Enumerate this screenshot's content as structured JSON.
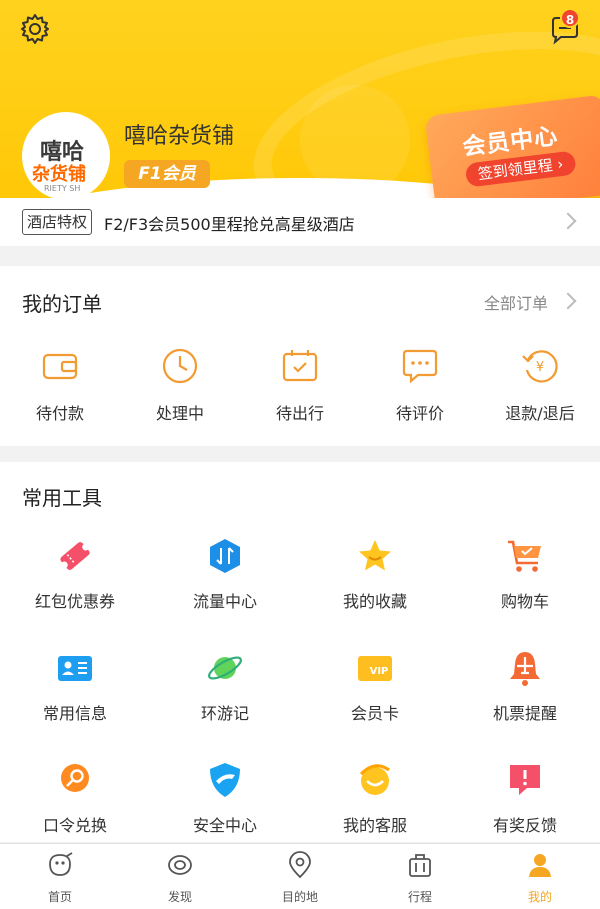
{
  "header": {
    "notification_count": "8",
    "avatar": {
      "line1": "嘻哈",
      "line2": "杂货铺",
      "line3": "RIETY SH"
    },
    "username": "嘻哈杂货铺",
    "level": "F1会员",
    "vip_card": {
      "title": "会员中心",
      "button": "签到领里程"
    }
  },
  "promo": {
    "tag": "酒店特权",
    "text": "F2/F3会员500里程抢兑高星级酒店"
  },
  "orders": {
    "title": "我的订单",
    "all_link": "全部订单",
    "items": [
      {
        "label": "待付款",
        "icon": "wallet-icon"
      },
      {
        "label": "处理中",
        "icon": "clock-icon"
      },
      {
        "label": "待出行",
        "icon": "calendar-check-icon"
      },
      {
        "label": "待评价",
        "icon": "comment-icon"
      },
      {
        "label": "退款/退后",
        "icon": "refund-icon"
      }
    ]
  },
  "tools": {
    "title": "常用工具",
    "items": [
      {
        "label": "红包优惠券",
        "icon": "coupon-icon"
      },
      {
        "label": "流量中心",
        "icon": "data-traffic-icon"
      },
      {
        "label": "我的收藏",
        "icon": "star-icon"
      },
      {
        "label": "购物车",
        "icon": "cart-icon"
      },
      {
        "label": "常用信息",
        "icon": "id-card-icon"
      },
      {
        "label": "环游记",
        "icon": "planet-icon"
      },
      {
        "label": "会员卡",
        "icon": "vip-card-icon"
      },
      {
        "label": "机票提醒",
        "icon": "bell-plane-icon"
      },
      {
        "label": "口令兑换",
        "icon": "search-key-icon"
      },
      {
        "label": "安全中心",
        "icon": "shield-icon"
      },
      {
        "label": "我的客服",
        "icon": "service-icon"
      },
      {
        "label": "有奖反馈",
        "icon": "feedback-icon"
      }
    ]
  },
  "tabbar": {
    "items": [
      {
        "label": "首页",
        "icon": "home-icon"
      },
      {
        "label": "发现",
        "icon": "discover-icon"
      },
      {
        "label": "目的地",
        "icon": "location-icon"
      },
      {
        "label": "行程",
        "icon": "luggage-icon"
      },
      {
        "label": "我的",
        "icon": "profile-icon"
      }
    ],
    "active": "我的"
  },
  "colors": {
    "header_yellow": "#ffd21f",
    "accent_orange": "#f5a623",
    "badge_red": "#f0442e"
  }
}
